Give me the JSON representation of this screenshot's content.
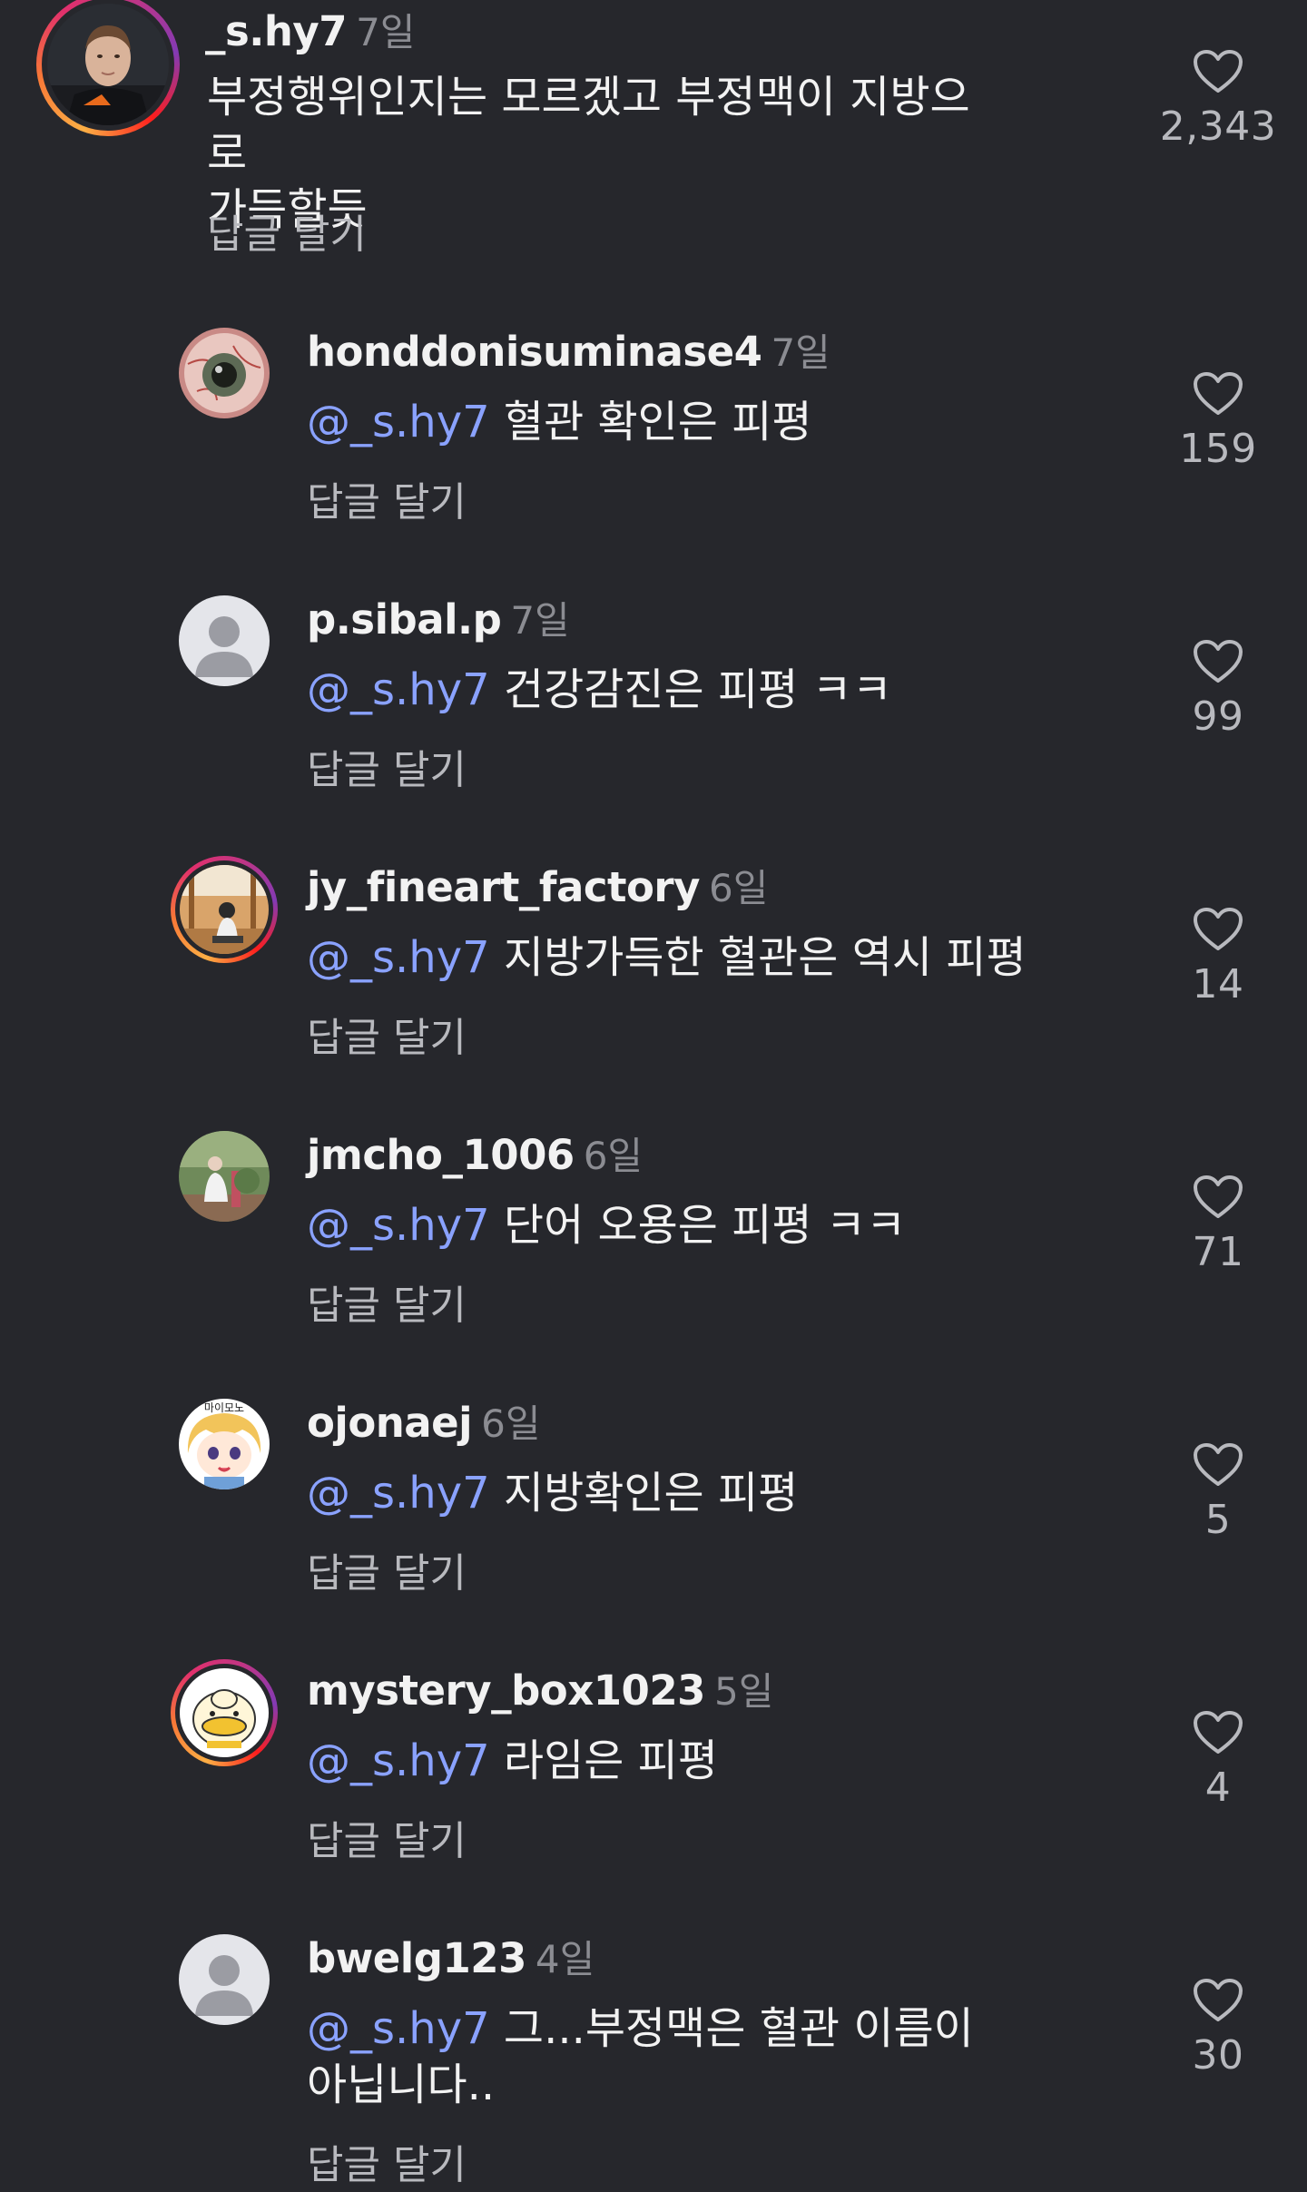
{
  "main_comment": {
    "username": "_s.hy7",
    "time": "7일",
    "text_line1": "부정행위인지는 모르겠고 부정맥이 지방으로",
    "text_line2": "가득할듯",
    "reply_label": "답글 달기",
    "likes": "2,343",
    "avatar_icon": "profile-photo-racing-driver"
  },
  "replies": [
    {
      "username": "honddonisuminase4",
      "time": "7일",
      "mention": "@_s.hy7",
      "text": "혈관 확인은 피평",
      "text_line2": "",
      "reply_label": "답글 달기",
      "likes": "159",
      "avatar_icon": "eyeball-avatar"
    },
    {
      "username": "p.sibal.p",
      "time": "7일",
      "mention": "@_s.hy7",
      "text": "건강감진은 피평 ㅋㅋ",
      "text_line2": "",
      "reply_label": "답글 달기",
      "likes": "99",
      "avatar_icon": "default-person-avatar"
    },
    {
      "username": "jy_fineart_factory",
      "time": "6일",
      "mention": "@_s.hy7",
      "text": "지방가득한 혈관은 역시 피평",
      "text_line2": "",
      "reply_label": "답글 달기",
      "likes": "14",
      "avatar_icon": "photo-avatar-person-sitting"
    },
    {
      "username": "jmcho_1006",
      "time": "6일",
      "mention": "@_s.hy7",
      "text": "단어 오용은 피평 ㅋㅋ",
      "text_line2": "",
      "reply_label": "답글 달기",
      "likes": "71",
      "avatar_icon": "photo-avatar-outdoor"
    },
    {
      "username": "ojonaej",
      "time": "6일",
      "mention": "@_s.hy7",
      "text": " 지방확인은 피평",
      "text_line2": "",
      "reply_label": "답글 달기",
      "likes": "5",
      "avatar_icon": "anime-character-avatar",
      "avatar_text": "마이모노"
    },
    {
      "username": "mystery_box1023",
      "time": "5일",
      "mention": "@_s.hy7",
      "text": "라임은 피평",
      "text_line2": "",
      "reply_label": "답글 달기",
      "likes": "4",
      "avatar_icon": "duck-character-avatar"
    },
    {
      "username": "bwelg123",
      "time": "4일",
      "mention": "@_s.hy7",
      "text": "그...부정맥은 혈관 이름이",
      "text_line2": "아닙니다..",
      "reply_label": "답글 달기",
      "likes": "30",
      "avatar_icon": "default-person-avatar"
    }
  ],
  "colors": {
    "background": "#26272c",
    "mention": "#8aa2ff",
    "muted": "#8b8c92"
  }
}
